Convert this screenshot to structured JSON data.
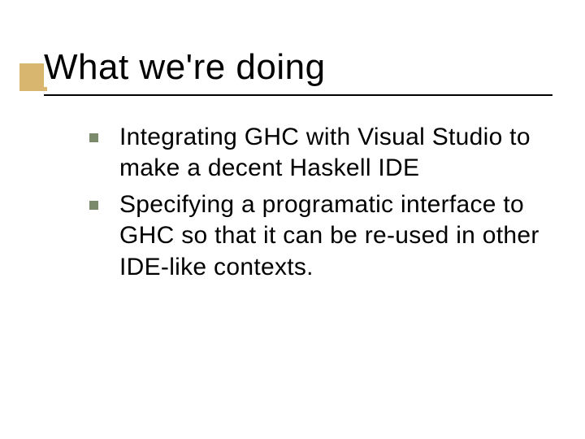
{
  "slide": {
    "title": "What we're doing",
    "bullets": [
      {
        "text": "Integrating GHC with Visual Studio to make a decent Haskell IDE"
      },
      {
        "text": "Specifying a programatic interface to GHC so that it can be re-used in other IDE-like contexts."
      }
    ]
  }
}
